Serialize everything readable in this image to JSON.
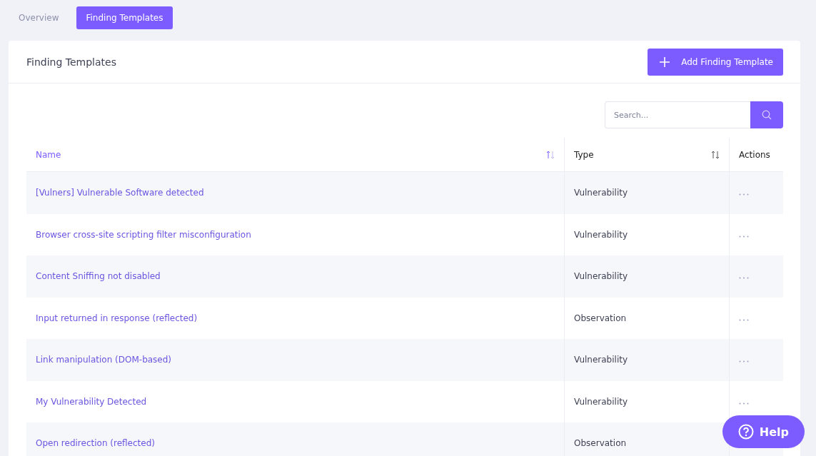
{
  "tabs": [
    {
      "label": "Overview",
      "selected": false
    },
    {
      "label": "Finding Templates",
      "selected": true
    }
  ],
  "card": {
    "title": "Finding Templates",
    "add_button": "Add Finding Template"
  },
  "search": {
    "placeholder": "Search..."
  },
  "table": {
    "columns": [
      {
        "label": "Name",
        "sorted": true
      },
      {
        "label": "Type",
        "sorted": false
      },
      {
        "label": "Actions"
      }
    ],
    "rows": [
      {
        "name": "[Vulners] Vulnerable Software detected",
        "type": "Vulnerability"
      },
      {
        "name": "Browser cross-site scripting filter misconfiguration",
        "type": "Vulnerability"
      },
      {
        "name": "Content Sniffing not disabled",
        "type": "Vulnerability"
      },
      {
        "name": "Input returned in response (reflected)",
        "type": "Observation"
      },
      {
        "name": "Link manipulation (DOM-based)",
        "type": "Vulnerability"
      },
      {
        "name": "My Vulnerability Detected",
        "type": "Vulnerability"
      },
      {
        "name": "Open redirection (reflected)",
        "type": "Observation"
      }
    ]
  },
  "help": {
    "label": "Help"
  }
}
